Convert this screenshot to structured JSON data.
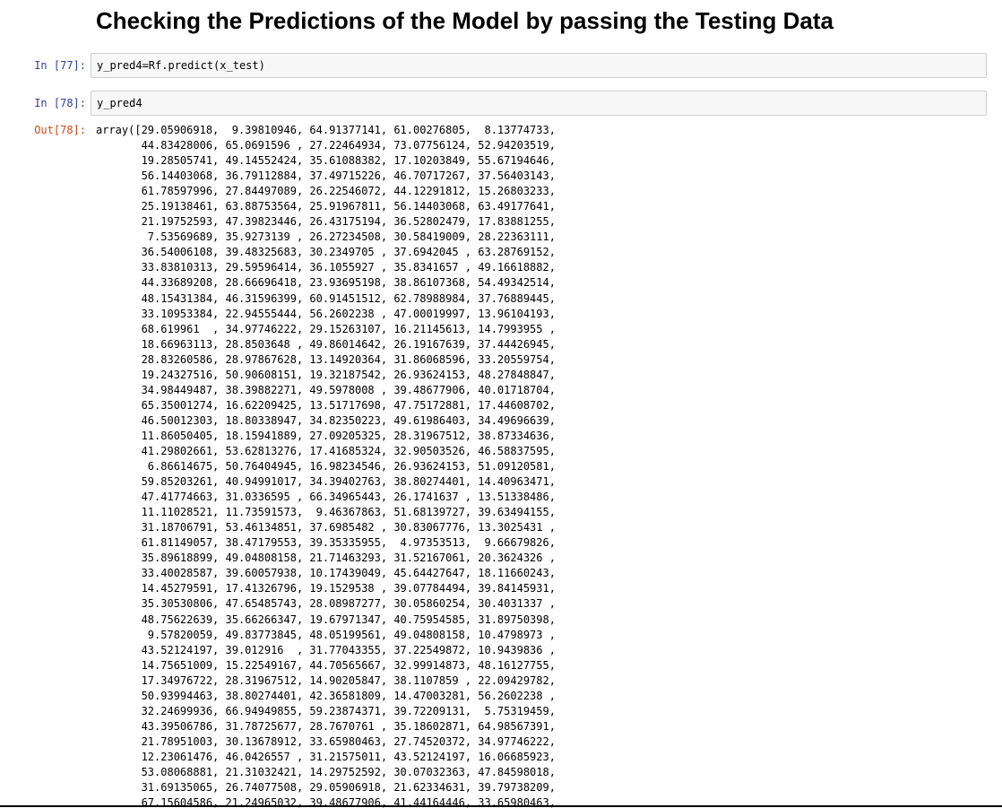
{
  "heading": "Checking the Predictions of the Model by passing the Testing Data",
  "cells": [
    {
      "prompt": "In [77]:",
      "code": "y_pred4=Rf.predict(x_test)"
    },
    {
      "prompt": "In [78]:",
      "code": "y_pred4"
    }
  ],
  "output": {
    "prompt": "Out[78]:",
    "text": "array([29.05906918,  9.39810946, 64.91377141, 61.00276805,  8.13774733,\n       44.83428006, 65.0691596 , 27.22464934, 73.07756124, 52.94203519,\n       19.28505741, 49.14552424, 35.61088382, 17.10203849, 55.67194646,\n       56.14403068, 36.79112884, 37.49715226, 46.70717267, 37.56403143,\n       61.78597996, 27.84497089, 26.22546072, 44.12291812, 15.26803233,\n       25.19138461, 63.88753564, 25.91967811, 56.14403068, 63.49177641,\n       21.19752593, 47.39823446, 26.43175194, 36.52802479, 17.83881255,\n        7.53569689, 35.9273139 , 26.27234508, 30.58419009, 28.22363111,\n       36.54006108, 39.48325683, 30.2349705 , 37.6942045 , 63.28769152,\n       33.83810313, 29.59596414, 36.1055927 , 35.8341657 , 49.16618882,\n       44.33689208, 28.66696418, 23.93695198, 38.86107368, 54.49342514,\n       48.15431384, 46.31596399, 60.91451512, 62.78988984, 37.76889445,\n       33.10953384, 22.94555444, 56.2602238 , 47.00019997, 13.96104193,\n       68.619961  , 34.97746222, 29.15263107, 16.21145613, 14.7993955 ,\n       18.66963113, 28.8503648 , 49.86014642, 26.19167639, 37.44426945,\n       28.83260586, 28.97867628, 13.14920364, 31.86068596, 33.20559754,\n       19.24327516, 50.90608151, 19.32187542, 26.93624153, 48.27848847,\n       34.98449487, 38.39882271, 49.5978008 , 39.48677906, 40.01718704,\n       65.35001274, 16.62209425, 13.51717698, 47.75172881, 17.44608702,\n       46.50012303, 18.80338947, 34.82350223, 49.61986403, 34.49696639,\n       11.86050405, 18.15941889, 27.09205325, 28.31967512, 38.87334636,\n       41.29802661, 53.62813276, 17.41685324, 32.90503526, 46.58837595,\n        6.86614675, 50.76404945, 16.98234546, 26.93624153, 51.09120581,\n       59.85203261, 40.94991017, 34.39402763, 38.80274401, 14.40963471,\n       47.41774663, 31.0336595 , 66.34965443, 26.1741637 , 13.51338486,\n       11.11028521, 11.73591573,  9.46367863, 51.68139727, 39.63494155,\n       31.18706791, 53.46134851, 37.6985482 , 30.83067776, 13.3025431 ,\n       61.81149057, 38.47179553, 39.35335955,  4.97353513,  9.66679826,\n       35.89618899, 49.04808158, 21.71463293, 31.52167061, 20.3624326 ,\n       33.40028587, 39.60057938, 10.17439049, 45.64427647, 18.11660243,\n       14.45279591, 17.41326796, 19.1529538 , 39.07784494, 39.84145931,\n       35.30530806, 47.65485743, 28.08987277, 30.05860254, 30.4031337 ,\n       48.75622639, 35.66266347, 19.67971347, 40.75954585, 31.89750398,\n        9.57820059, 49.83773845, 48.05199561, 49.04808158, 10.4798973 ,\n       43.52124197, 39.012916  , 31.77043355, 37.22549872, 10.9439836 ,\n       14.75651009, 15.22549167, 44.70565667, 32.99914873, 48.16127755,\n       17.34976722, 28.31967512, 14.90205847, 38.1107859 , 22.09429782,\n       50.93994463, 38.80274401, 42.36581809, 14.47003281, 56.2602238 ,\n       32.24699936, 66.94949855, 59.23874371, 39.72209131,  5.75319459,\n       43.39506786, 31.78725677, 28.7670761 , 35.18602871, 64.98567391,\n       21.78951003, 30.13678912, 33.65980463, 27.74520372, 34.97746222,\n       12.23061476, 46.0426557 , 31.21575011, 43.52124197, 16.06685923,\n       53.08068881, 21.31032421, 14.29752592, 30.07032363, 47.84598018,\n       31.69135065, 26.74077508, 29.05906918, 21.62334631, 39.79738209,\n       67.15604586, 21.24965032, 39.48677906, 41.44164446, 33.65980463,"
  }
}
